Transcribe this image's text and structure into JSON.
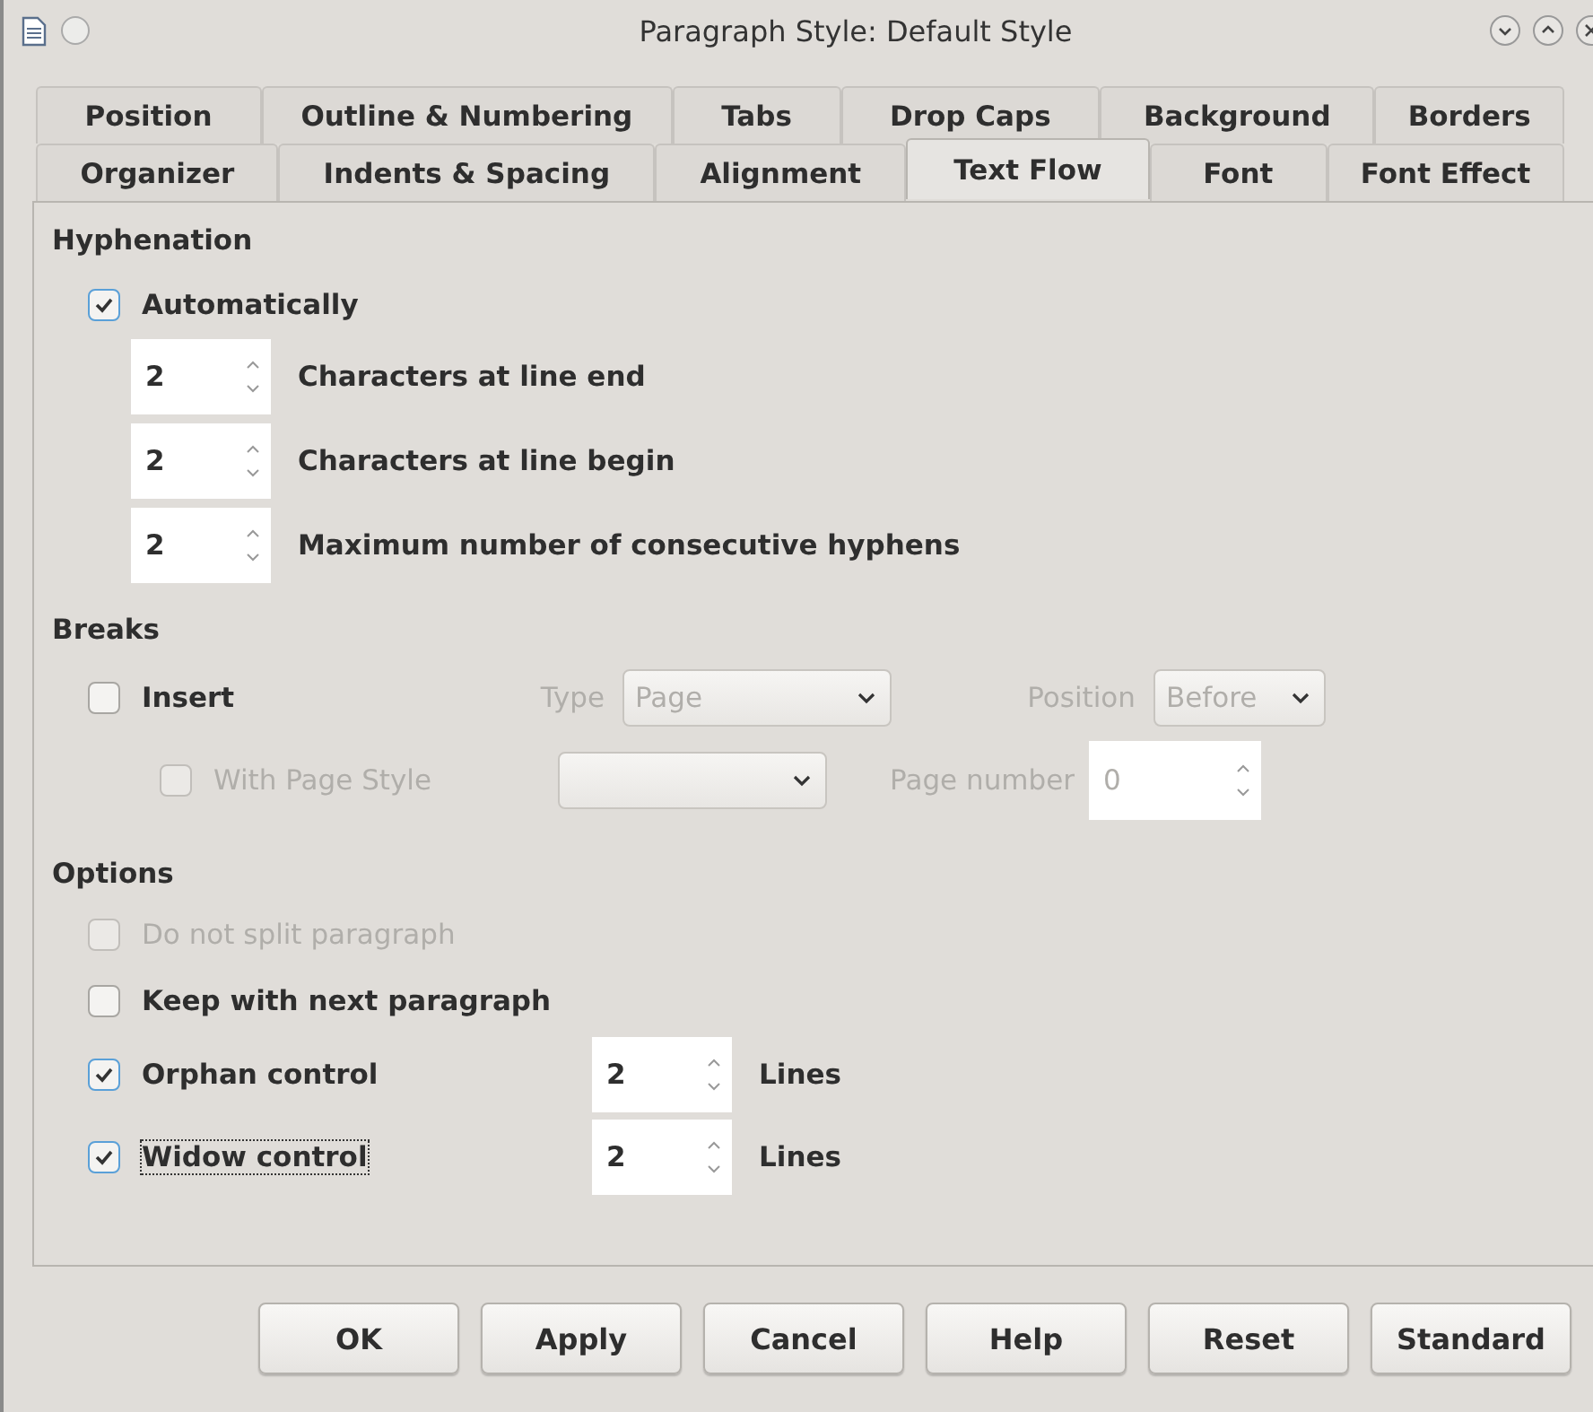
{
  "window": {
    "title": "Paragraph Style: Default Style"
  },
  "tab_rows": [
    {
      "tabs": [
        {
          "label": "Position",
          "selected": false
        },
        {
          "label": "Outline & Numbering",
          "selected": false
        },
        {
          "label": "Tabs",
          "selected": false
        },
        {
          "label": "Drop Caps",
          "selected": false
        },
        {
          "label": "Background",
          "selected": false
        },
        {
          "label": "Borders",
          "selected": false
        }
      ]
    },
    {
      "tabs": [
        {
          "label": "Organizer",
          "selected": false
        },
        {
          "label": "Indents & Spacing",
          "selected": false
        },
        {
          "label": "Alignment",
          "selected": false
        },
        {
          "label": "Text Flow",
          "selected": true
        },
        {
          "label": "Font",
          "selected": false
        },
        {
          "label": "Font Effect",
          "selected": false
        }
      ]
    }
  ],
  "hyphenation": {
    "heading": "Hyphenation",
    "automatically": {
      "label": "Automatically",
      "checked": true
    },
    "spinners": [
      {
        "value": "2",
        "label": "Characters at line end"
      },
      {
        "value": "2",
        "label": "Characters at line begin"
      },
      {
        "value": "2",
        "label": "Maximum number of consecutive hyphens"
      }
    ]
  },
  "breaks": {
    "heading": "Breaks",
    "disabled": true,
    "insert": {
      "label": "Insert",
      "checked": false
    },
    "type_label": "Type",
    "type_value": "Page",
    "position_label": "Position",
    "position_value": "Before",
    "page_style": {
      "label": "With Page Style",
      "checked": false
    },
    "page_number_label": "Page number",
    "page_number_value": "0"
  },
  "options": {
    "heading": "Options",
    "items": [
      {
        "kind": "checkbox",
        "label": "Do not split paragraph",
        "checked": false,
        "disabled": true,
        "focused": false
      },
      {
        "kind": "checkbox",
        "label": "Keep with next paragraph",
        "checked": false,
        "disabled": false,
        "focused": false
      },
      {
        "kind": "spin",
        "label": "Orphan control",
        "checked": true,
        "disabled": false,
        "focused": false,
        "value": "2",
        "unit": "Lines"
      },
      {
        "kind": "spin",
        "label": "Widow control",
        "checked": true,
        "disabled": false,
        "focused": true,
        "value": "2",
        "unit": "Lines"
      }
    ]
  },
  "buttons": [
    "OK",
    "Apply",
    "Cancel",
    "Help",
    "Reset",
    "Standard"
  ]
}
